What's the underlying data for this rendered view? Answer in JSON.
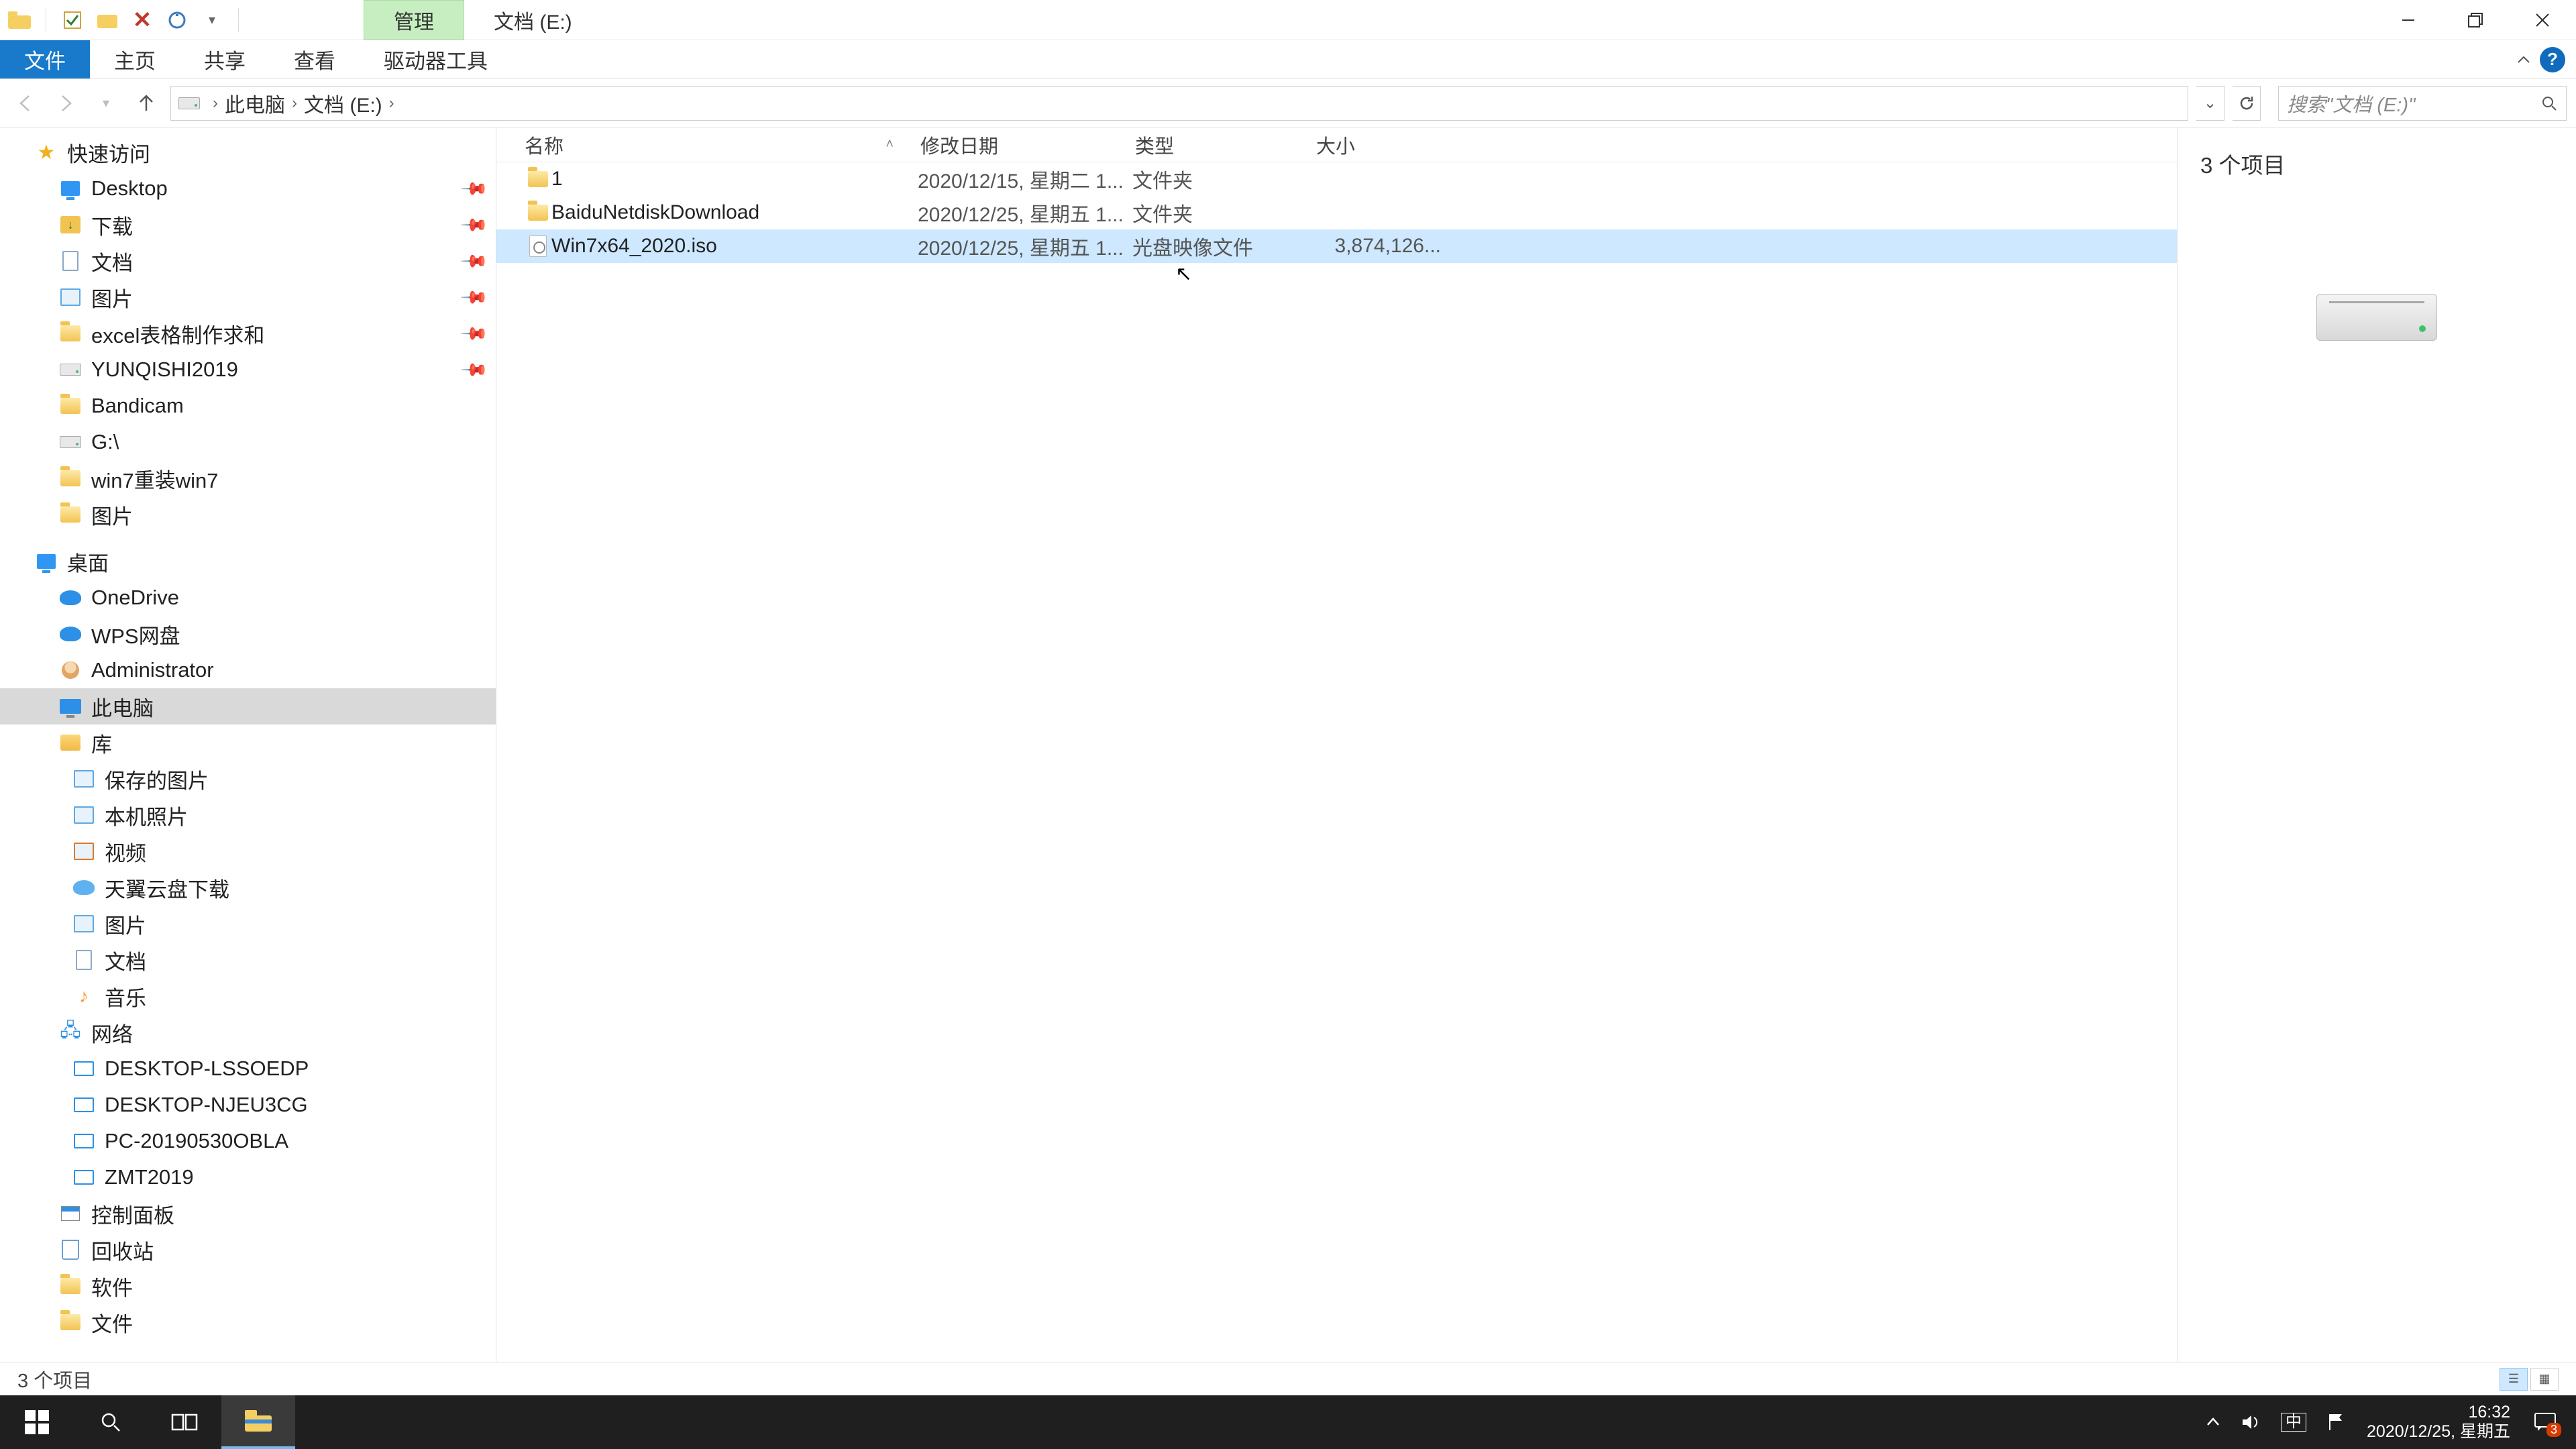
{
  "titlebar": {
    "manage_tab": "管理",
    "location_tab": "文档 (E:)"
  },
  "ribbon": {
    "file": "文件",
    "home": "主页",
    "share": "共享",
    "view": "查看",
    "drive_tools": "驱动器工具"
  },
  "address": {
    "crumb1": "此电脑",
    "crumb2": "文档 (E:)"
  },
  "search": {
    "placeholder": "搜索\"文档 (E:)\""
  },
  "nav": {
    "quick_access": "快速访问",
    "desktop": "Desktop",
    "downloads": "下载",
    "documents": "文档",
    "pictures": "图片",
    "excel": "excel表格制作求和",
    "yunqishi": "YUNQISHI2019",
    "bandicam": "Bandicam",
    "gdrive": "G:\\",
    "win7reinstall": "win7重装win7",
    "pictures2": "图片",
    "desktop_root": "桌面",
    "onedrive": "OneDrive",
    "wps": "WPS网盘",
    "admin": "Administrator",
    "this_pc": "此电脑",
    "libraries": "库",
    "saved_pictures": "保存的图片",
    "camera_roll": "本机照片",
    "videos": "视频",
    "tianyi": "天翼云盘下载",
    "pictures3": "图片",
    "documents2": "文档",
    "music": "音乐",
    "network": "网络",
    "net1": "DESKTOP-LSSOEDP",
    "net2": "DESKTOP-NJEU3CG",
    "net3": "PC-20190530OBLA",
    "net4": "ZMT2019",
    "control_panel": "控制面板",
    "recycle": "回收站",
    "software": "软件",
    "files": "文件"
  },
  "columns": {
    "name": "名称",
    "date": "修改日期",
    "type": "类型",
    "size": "大小"
  },
  "files": [
    {
      "name": "1",
      "date": "2020/12/15, 星期二 1...",
      "type": "文件夹",
      "size": "",
      "icon": "folder"
    },
    {
      "name": "BaiduNetdiskDownload",
      "date": "2020/12/25, 星期五 1...",
      "type": "文件夹",
      "size": "",
      "icon": "folder"
    },
    {
      "name": "Win7x64_2020.iso",
      "date": "2020/12/25, 星期五 1...",
      "type": "光盘映像文件",
      "size": "3,874,126...",
      "icon": "iso",
      "selected": true
    }
  ],
  "details": {
    "heading": "3 个项目"
  },
  "status": {
    "text": "3 个项目"
  },
  "taskbar": {
    "ime": "中",
    "time": "16:32",
    "date": "2020/12/25, 星期五",
    "notif_count": "3"
  }
}
